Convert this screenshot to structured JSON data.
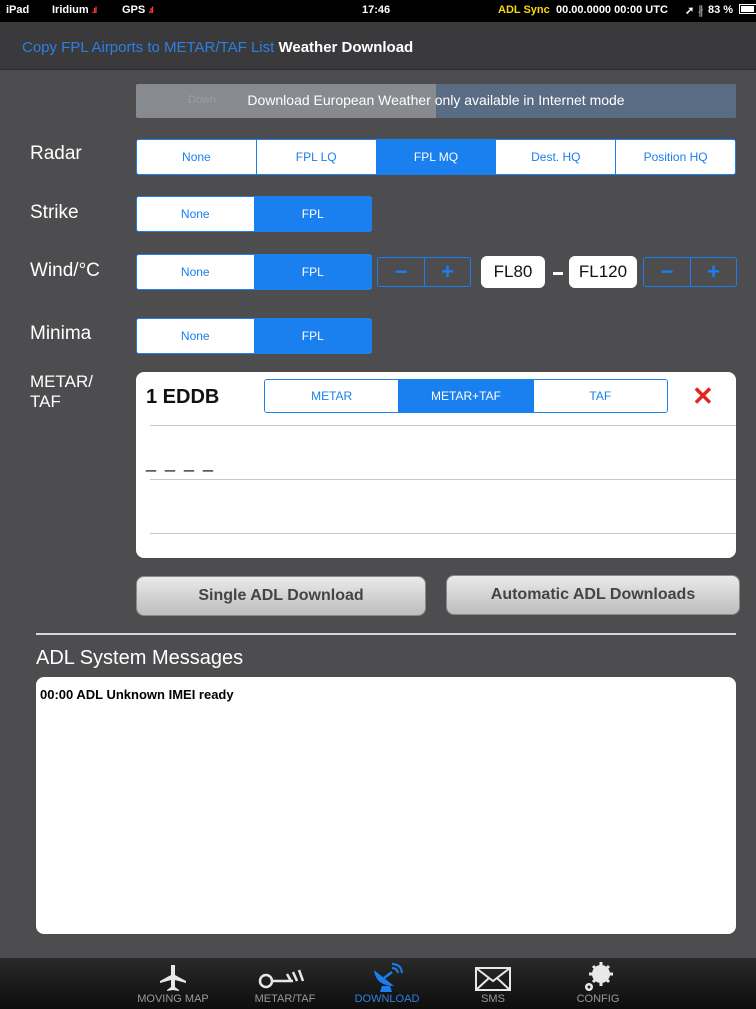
{
  "statusbar": {
    "device": "iPad",
    "carrier1": "Iridium",
    "carrier1_signal": ".ıl",
    "carrier2": "GPS",
    "carrier2_signal": ".ıl",
    "time": "17:46",
    "adl_sync_label": "ADL Sync",
    "adl_sync_value": "00.00.0000 00:00 UTC",
    "battery": "83 %",
    "battery_level": 0.83
  },
  "header": {
    "link": "Copy FPL Airports to METAR/TAF List",
    "title": "Weather Download"
  },
  "banner": {
    "hidden_text": "Down",
    "text": "Download European Weather only available in Internet mode",
    "progress": 0.5
  },
  "radar": {
    "label": "Radar",
    "options": [
      "None",
      "FPL LQ",
      "FPL MQ",
      "Dest. HQ",
      "Position HQ"
    ],
    "selected": "FPL MQ"
  },
  "strike": {
    "label": "Strike",
    "options": [
      "None",
      "FPL"
    ],
    "selected": "FPL"
  },
  "wind": {
    "label": "Wind/°C",
    "options": [
      "None",
      "FPL"
    ],
    "selected": "FPL",
    "minus": "−",
    "plus": "+",
    "fl_low": "FL80",
    "fl_high": "FL120"
  },
  "minima": {
    "label": "Minima",
    "options": [
      "None",
      "FPL"
    ],
    "selected": "FPL"
  },
  "metar": {
    "label": "METAR/ TAF",
    "station": "1 EDDB",
    "options": [
      "METAR",
      "METAR+TAF",
      "TAF"
    ],
    "selected": "METAR+TAF",
    "delete": "✕",
    "report": "_ _ _ _"
  },
  "buttons": {
    "single": "Single ADL Download",
    "automatic": "Automatic ADL Downloads"
  },
  "messages": {
    "title": "ADL System Messages",
    "lines": [
      "00:00 ADL Unknown IMEI ready"
    ]
  },
  "tabs": [
    {
      "label": "MOVING MAP",
      "icon": "airplane-icon"
    },
    {
      "label": "METAR/TAF",
      "icon": "windsock-icon"
    },
    {
      "label": "DOWNLOAD",
      "icon": "satellite-dish-icon",
      "active": true
    },
    {
      "label": "SMS",
      "icon": "envelope-icon"
    },
    {
      "label": "CONFIG",
      "icon": "gear-icon"
    }
  ],
  "colors": {
    "accent": "#1a7fef",
    "background": "#4d4d4f",
    "adl_sync": "#f5d90a",
    "delete": "#e0261e"
  }
}
